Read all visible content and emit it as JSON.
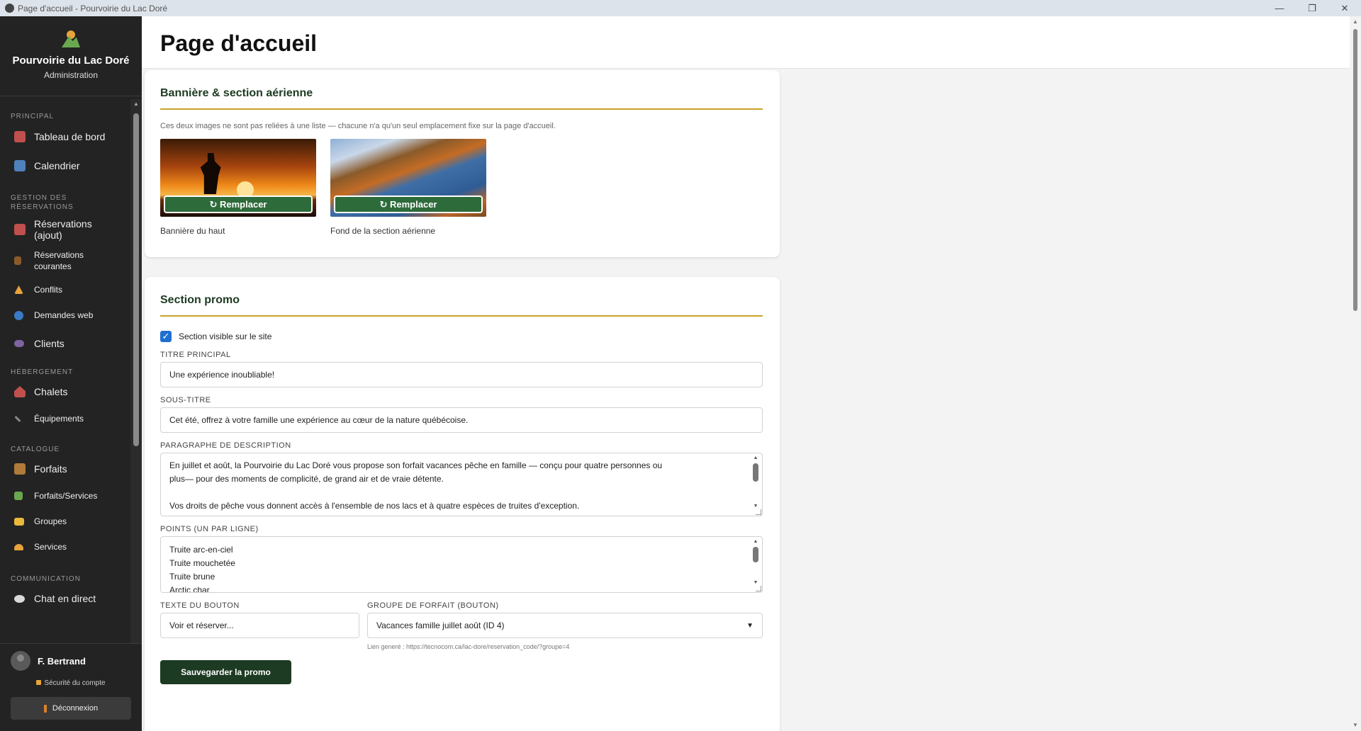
{
  "window": {
    "title": "Page d'accueil - Pourvoirie du Lac Doré",
    "controls": [
      "—",
      "❐",
      "✕"
    ]
  },
  "brand": {
    "name": "Pourvoirie du Lac Doré",
    "subtitle": "Administration"
  },
  "sidebar": {
    "sections": [
      {
        "label": "PRINCIPAL",
        "items": [
          {
            "label": "Tableau de bord",
            "icon": "chart-icon",
            "color": "#c0504d"
          },
          {
            "label": "Calendrier",
            "icon": "calendar-icon",
            "color": "#4f81bd"
          }
        ]
      },
      {
        "label": "GESTION DES RÉSERVATIONS",
        "items": [
          {
            "label": "Réservations (ajout)",
            "icon": "clipboard-icon",
            "color": "#c0504d"
          },
          {
            "label": "Réservations courantes",
            "icon": "book-icon",
            "color": "#8b5a2b"
          },
          {
            "label": "Conflits",
            "icon": "warning-icon",
            "color": "#e8a33b"
          },
          {
            "label": "Demandes web",
            "icon": "globe-icon",
            "color": "#3a7bc8"
          },
          {
            "label": "Clients",
            "icon": "people-icon",
            "color": "#8064a2"
          }
        ]
      },
      {
        "label": "HÉBERGEMENT",
        "items": [
          {
            "label": "Chalets",
            "icon": "house-icon",
            "color": "#c0504d"
          },
          {
            "label": "Équipements",
            "icon": "wrench-icon",
            "color": "#888888"
          }
        ]
      },
      {
        "label": "CATALOGUE",
        "items": [
          {
            "label": "Forfaits",
            "icon": "package-icon",
            "color": "#b07a3b"
          },
          {
            "label": "Forfaits/Services",
            "icon": "puzzle-icon",
            "color": "#6aa84f"
          },
          {
            "label": "Groupes",
            "icon": "folder-icon",
            "color": "#e8b93b"
          },
          {
            "label": "Services",
            "icon": "bell-icon",
            "color": "#e8a33b"
          }
        ]
      },
      {
        "label": "COMMUNICATION",
        "items": [
          {
            "label": "Chat en direct",
            "icon": "chat-bubble-icon",
            "color": "#d9d9d9"
          }
        ]
      }
    ]
  },
  "user": {
    "name": "F. Bertrand",
    "security_label": "Sécurité du compte",
    "logout_label": "Déconnexion"
  },
  "page": {
    "title": "Page d'accueil"
  },
  "banner_card": {
    "title": "Bannière & section aérienne",
    "hint": "Ces deux images ne sont pas reliées à une liste — chacune n'a qu'un seul emplacement fixe sur la page d'accueil.",
    "images": [
      {
        "caption": "Bannière du haut",
        "button": "↻ Remplacer"
      },
      {
        "caption": "Fond de la section aérienne",
        "button": "↻ Remplacer"
      }
    ]
  },
  "promo_card": {
    "title": "Section promo",
    "visible_label": "Section visible sur le site",
    "visible_checked": true,
    "main_title_label": "TITRE PRINCIPAL",
    "main_title_value": "Une expérience inoubliable!",
    "subtitle_label": "SOUS-TITRE",
    "subtitle_value": "Cet été, offrez à votre famille une expérience au cœur de la nature québécoise.",
    "description_label": "PARAGRAPHE DE DESCRIPTION",
    "description_lines": [
      "En juillet et août, la Pourvoirie du Lac Doré vous propose son forfait vacances pêche en famille — conçu pour quatre personnes ou",
      "plus— pour des moments de complicité, de grand air et de vraie détente.",
      "",
      "Vos droits de pêche vous donnent accès à l'ensemble de nos lacs et à quatre espèces de truites d'exception."
    ],
    "points_label": "POINTS (UN PAR LIGNE)",
    "points": [
      "Truite arc-en-ciel",
      "Truite mouchetée",
      "Truite brune",
      "Arctic char"
    ],
    "button_text_label": "TEXTE DU BOUTON",
    "button_text_value": "Voir et réserver...",
    "group_label": "GROUPE DE FORFAIT (BOUTON)",
    "group_value": "Vacances famille juillet août (ID 4)",
    "link_hint": "Lien generé : https://tecnocom.ca/lac-dore/reservation_code/?groupe=4",
    "save_label": "Sauvegarder la promo"
  }
}
